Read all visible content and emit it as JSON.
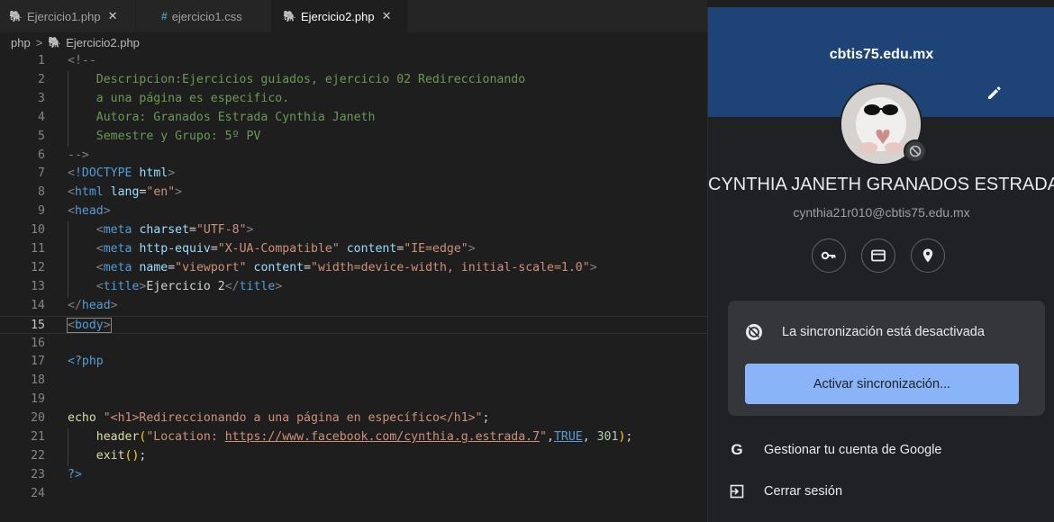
{
  "editor": {
    "tabs": [
      {
        "label": "Ejercicio1.php",
        "icon": "php-icon",
        "close": "✕"
      },
      {
        "label": "ejercicio1.css",
        "icon": "css-icon",
        "symbol": "#"
      },
      {
        "label": "Ejercicio2.php",
        "icon": "php-icon",
        "close": "✕"
      }
    ],
    "breadcrumb": {
      "folder": "php",
      "separator": ">",
      "file": "Ejercicio2.php"
    },
    "current_line": 15
  },
  "profile": {
    "domain": "cbtis75.edu.mx",
    "name": "CYNTHIA JANETH GRANADOS ESTRADA",
    "email": "cynthia21r010@cbtis75.edu.mx",
    "icons": [
      "key-icon",
      "credit-card-icon",
      "location-pin-icon"
    ],
    "sync_status": "La sincronización está desactivada",
    "sync_button": "Activar sincronización...",
    "manage_account": "Gestionar tu cuenta de Google",
    "sign_out": "Cerrar sesión",
    "header_color": "#1e4376",
    "button_color": "#8ab4f8"
  }
}
